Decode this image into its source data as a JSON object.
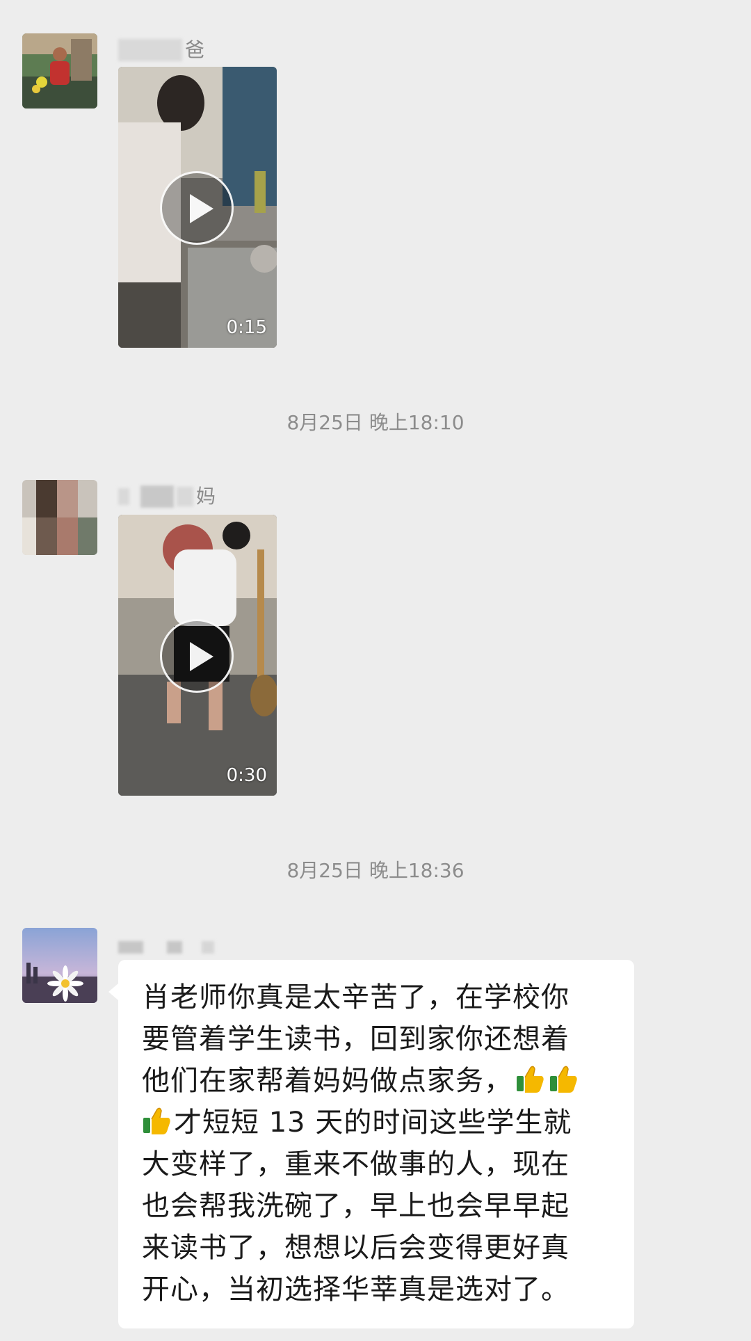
{
  "messages": [
    {
      "sender_suffix": "爸",
      "video_duration": "0:15"
    },
    {
      "timestamp": "8月25日 晚上18:10",
      "sender_suffix": "妈",
      "video_duration": "0:30"
    },
    {
      "timestamp": "8月25日 晚上18:36",
      "text_lines": [
        "肖老师你真是太辛苦了，在学校你",
        "要管着学生读书，回到家你还想着",
        "他们在家帮着妈妈做点家务，",
        "才短短 13 天的时间这些学生就",
        "大变样了，重来不做事的人，现在",
        "也会帮我洗碗了，早上也会早早起",
        "来读书了，想想以后会变得更好真",
        "开心，当初选择华莘真是选对了。"
      ]
    }
  ],
  "icons": {
    "play": "play-icon",
    "thumbs_up": "thumbs-up-emoji"
  },
  "colors": {
    "background": "#ededed",
    "bubble": "#ffffff",
    "meta_text": "#8c8c8c",
    "message_text": "#1a1a1a"
  }
}
